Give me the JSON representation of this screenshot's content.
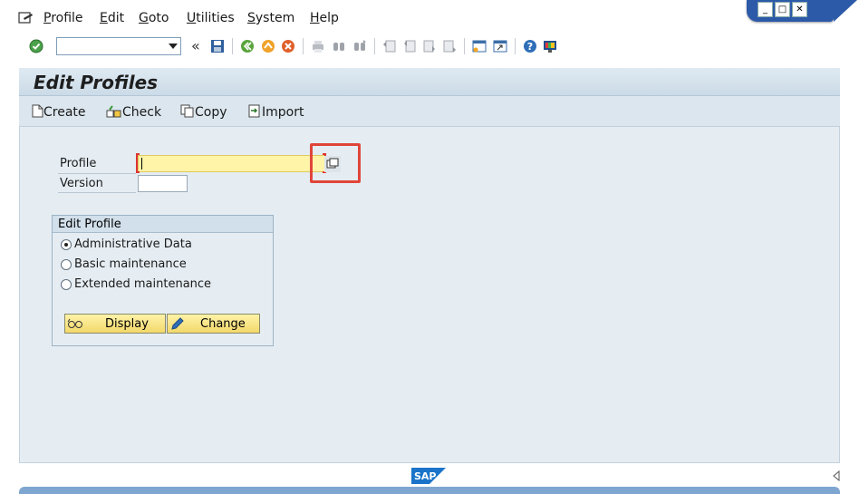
{
  "menu": {
    "items": [
      {
        "label": "Profile",
        "u": "P"
      },
      {
        "label": "Edit",
        "u": "E"
      },
      {
        "label": "Goto",
        "u": "G"
      },
      {
        "label": "Utilities",
        "u": "U"
      },
      {
        "label": "System",
        "u": "S"
      },
      {
        "label": "Help",
        "u": "H"
      }
    ]
  },
  "window_controls": {
    "minimize": "_",
    "maximize": "□",
    "close": "✕"
  },
  "toolbar": {
    "command_value": "",
    "icons": [
      "enter-icon",
      "command-field",
      "collapse-icon",
      "save-icon",
      "back-icon",
      "exit-icon",
      "cancel-icon",
      "print-icon",
      "find-icon",
      "find-next-icon",
      "first-page-icon",
      "previous-page-icon",
      "next-page-icon",
      "last-page-icon",
      "create-session-icon",
      "shortcut-icon",
      "help-icon",
      "layout-icon"
    ]
  },
  "title": "Edit Profiles",
  "app_toolbar": {
    "create": "Create",
    "check": "Check",
    "copy": "Copy",
    "import": "Import"
  },
  "form": {
    "profile_label": "Profile",
    "profile_value": "",
    "version_label": "Version",
    "version_value": ""
  },
  "edit_profile": {
    "title": "Edit Profile",
    "options": [
      "Administrative Data",
      "Basic maintenance",
      "Extended maintenance"
    ],
    "selected": "Administrative Data",
    "display_label": "Display",
    "change_label": "Change"
  },
  "footer": {
    "logo_text": "SAP"
  },
  "colors": {
    "accent": "#2c5aa8",
    "highlight": "#e0453a",
    "required_field": "#fff4a8"
  }
}
